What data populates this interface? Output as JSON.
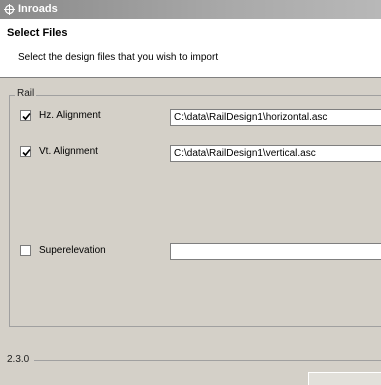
{
  "window": {
    "title": "Inroads"
  },
  "header": {
    "title": "Select Files",
    "subtitle": "Select the design files that you wish to import"
  },
  "rail_group": {
    "label": "Rail",
    "rows": [
      {
        "label": "Hz. Alignment",
        "checked": true,
        "path": "C:\\data\\RailDesign1\\horizontal.asc"
      },
      {
        "label": "Vt. Alignment",
        "checked": true,
        "path": "C:\\data\\RailDesign1\\vertical.asc"
      },
      {
        "label": "Superelevation",
        "checked": false,
        "path": ""
      }
    ]
  },
  "footer": {
    "version": "2.3.0"
  }
}
